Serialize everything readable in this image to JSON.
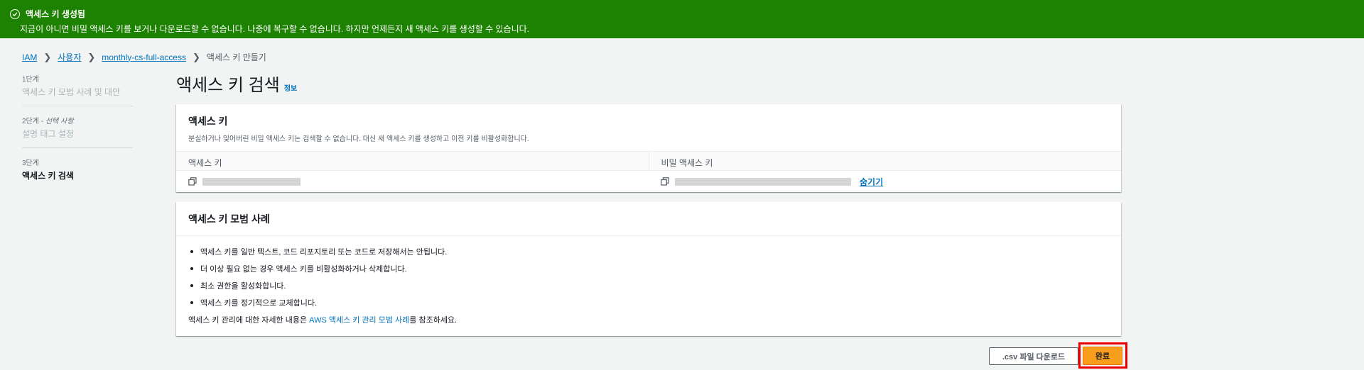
{
  "flash": {
    "title": "액세스 키 생성됨",
    "message": "지금이 아니면 비밀 액세스 키를 보거나 다운로드할 수 없습니다. 나중에 복구할 수 없습니다. 하지만 언제든지 새 액세스 키를 생성할 수 있습니다.",
    "color": "#1d8102"
  },
  "breadcrumb": {
    "items": [
      "IAM",
      "사용자",
      "monthly-cs-full-access"
    ],
    "current": "액세스 키 만들기"
  },
  "steps": [
    {
      "num": "1단계",
      "name": "액세스 키 모범 사례 및 대안"
    },
    {
      "num": "2단계",
      "optional": "선택 사항",
      "name": "설명 태그 설정"
    },
    {
      "num": "3단계",
      "name": "액세스 키 검색"
    }
  ],
  "page": {
    "title": "액세스 키 검색",
    "info": "정보"
  },
  "access_key_card": {
    "title": "액세스 키",
    "description": "분실하거나 잊어버린 비밀 액세스 키는 검색할 수 없습니다. 대신 새 액세스 키를 생성하고 이전 키를 비활성화합니다.",
    "col_access_key": "액세스 키",
    "col_secret_key": "비밀 액세스 키",
    "hide_label": "숨기기"
  },
  "best_practices": {
    "title": "액세스 키 모범 사례",
    "items": [
      "액세스 키를 일반 텍스트, 코드 리포지토리 또는 코드로 저장해서는 안됩니다.",
      "더 이상 필요 없는 경우 액세스 키를 비활성화하거나 삭제합니다.",
      "최소 권한을 활성화합니다.",
      "액세스 키를 정기적으로 교체합니다."
    ],
    "more_prefix": "액세스 키 관리에 대한 자세한 내용은 ",
    "more_link": "AWS 액세스 키 관리 모범 사례",
    "more_suffix": "를 참조하세요."
  },
  "buttons": {
    "download_csv": ".csv 파일 다운로드",
    "done": "완료",
    "done_color": "#f89e1b"
  }
}
